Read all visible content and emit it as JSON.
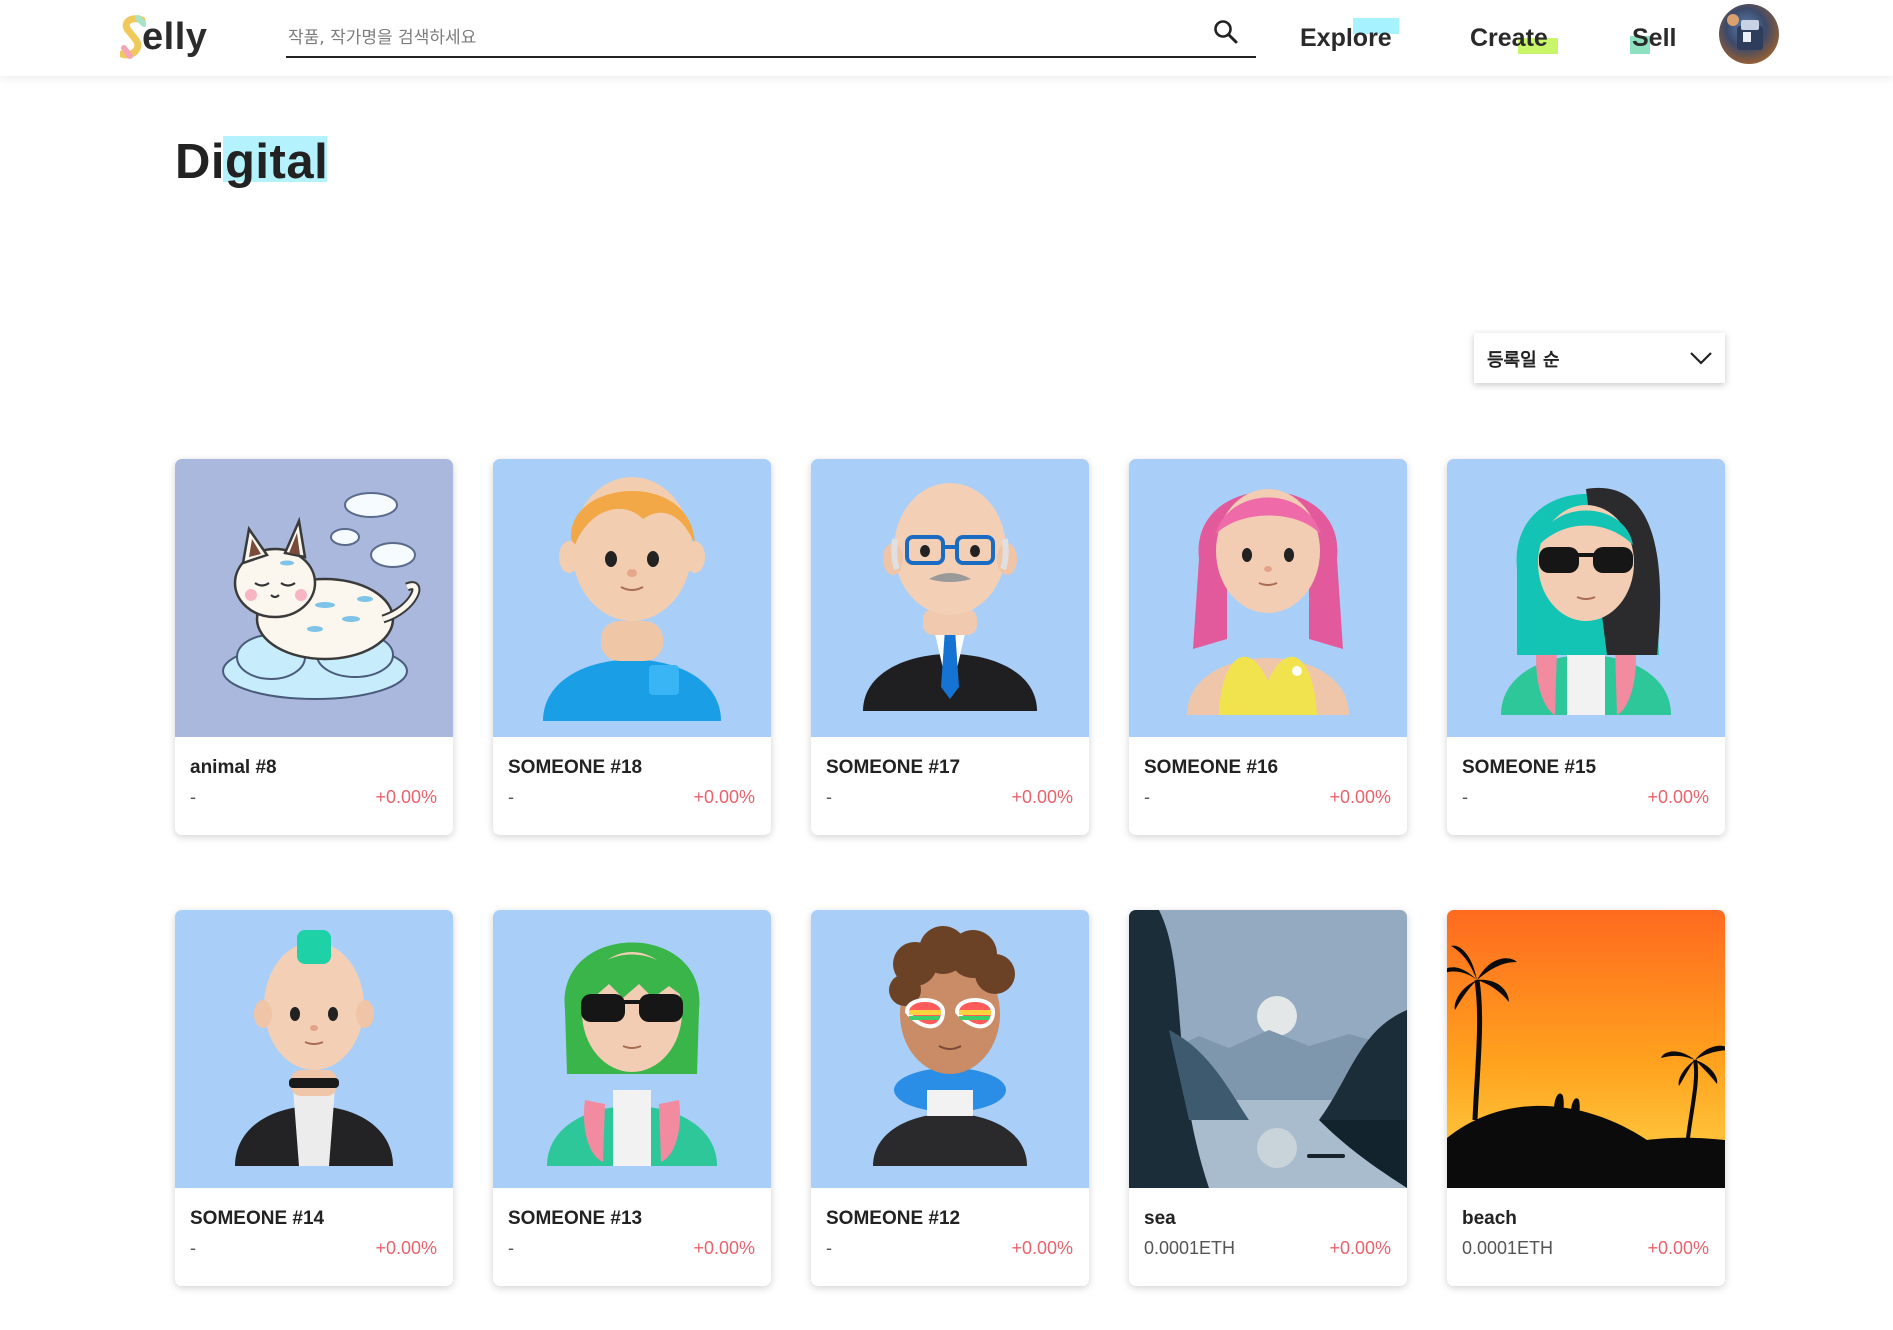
{
  "brand": {
    "logo_text": "elly"
  },
  "search": {
    "placeholder": "작품, 작가명을 검색하세요"
  },
  "nav": {
    "explore": "Explore",
    "create": "Create",
    "sell": "Sell"
  },
  "page": {
    "title": "Digital"
  },
  "sort": {
    "selected": "등록일 순"
  },
  "items": [
    {
      "name": "animal #8",
      "price": "-",
      "change": "+0.00%",
      "art": "cat"
    },
    {
      "name": "SOMEONE #18",
      "price": "-",
      "change": "+0.00%",
      "art": "avatar-orange-hair"
    },
    {
      "name": "SOMEONE #17",
      "price": "-",
      "change": "+0.00%",
      "art": "avatar-bald-glasses"
    },
    {
      "name": "SOMEONE #16",
      "price": "-",
      "change": "+0.00%",
      "art": "avatar-pink-hair"
    },
    {
      "name": "SOMEONE #15",
      "price": "-",
      "change": "+0.00%",
      "art": "avatar-teal-hair-sunglasses"
    },
    {
      "name": "SOMEONE #14",
      "price": "-",
      "change": "+0.00%",
      "art": "avatar-mohawk"
    },
    {
      "name": "SOMEONE #13",
      "price": "-",
      "change": "+0.00%",
      "art": "avatar-green-hair-sunglasses"
    },
    {
      "name": "SOMEONE #12",
      "price": "-",
      "change": "+0.00%",
      "art": "avatar-curly-rainbow-glasses"
    },
    {
      "name": "sea",
      "price": "0.0001ETH",
      "change": "+0.00%",
      "art": "sea-landscape"
    },
    {
      "name": "beach",
      "price": "0.0001ETH",
      "change": "+0.00%",
      "art": "beach-sunset"
    }
  ],
  "colors": {
    "accent_change": "#e8636d",
    "card_bg_blue": "#a9cff9",
    "highlight_cyan": "#b4f2fd",
    "highlight_lime": "#c9f56a"
  }
}
